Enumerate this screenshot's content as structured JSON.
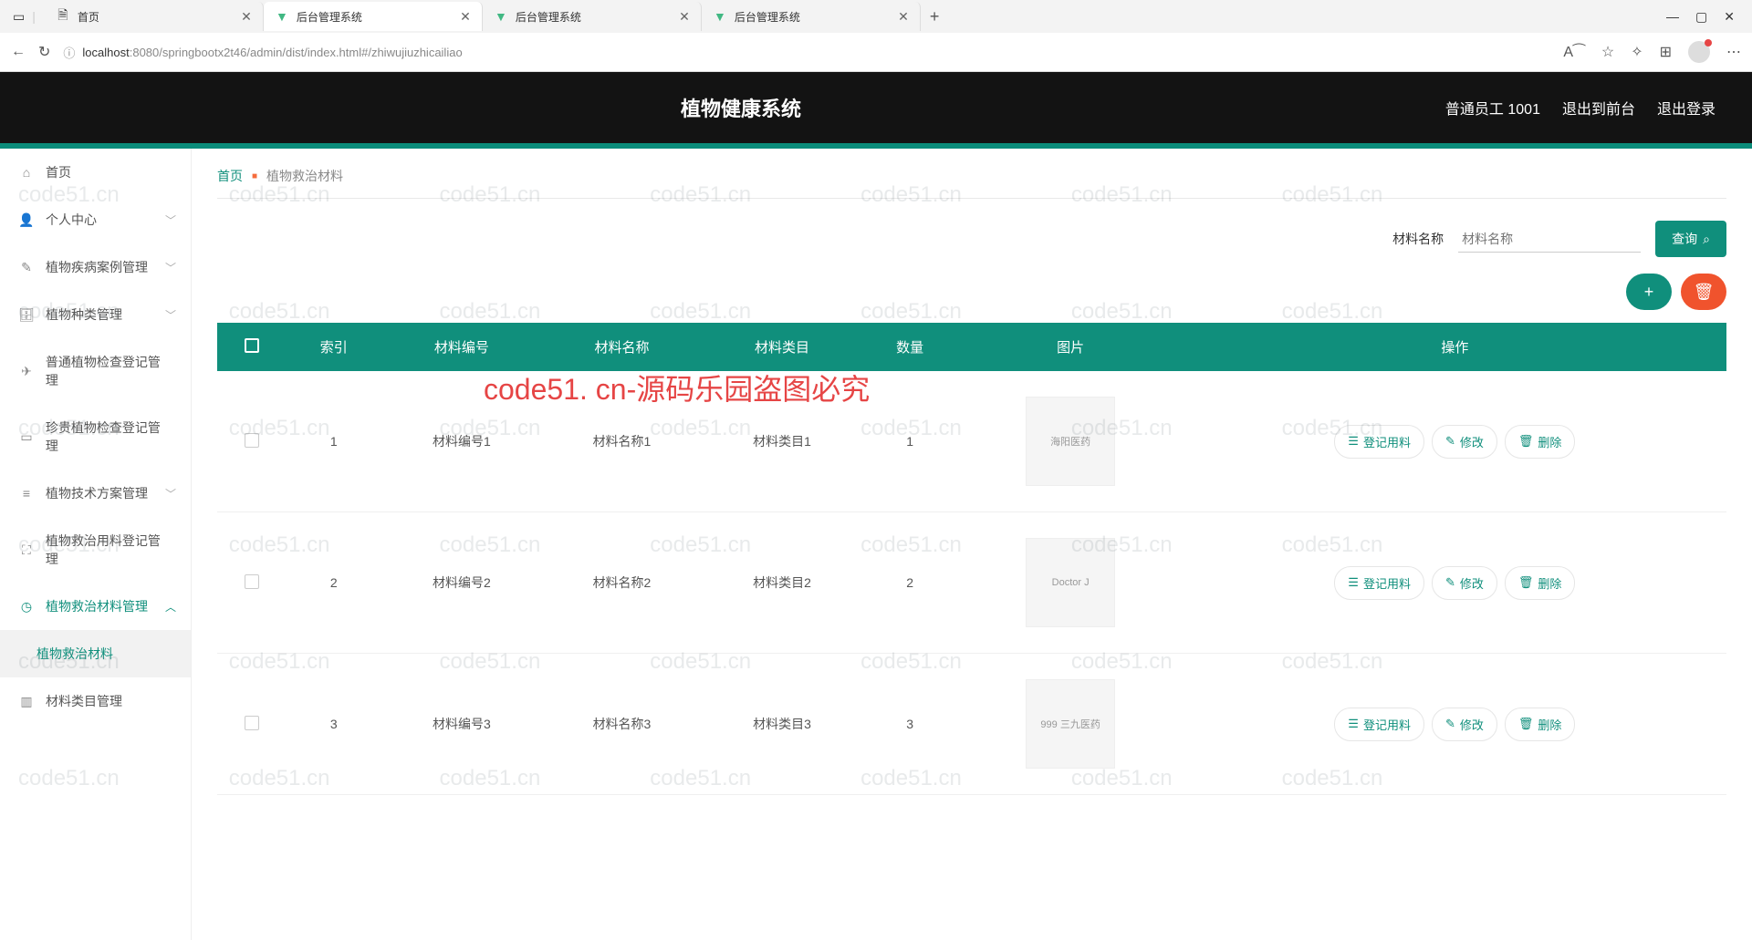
{
  "browser": {
    "tabs": [
      {
        "title": "首页",
        "icon": "doc"
      },
      {
        "title": "后台管理系统",
        "icon": "vue"
      },
      {
        "title": "后台管理系统",
        "icon": "vue"
      },
      {
        "title": "后台管理系统",
        "icon": "vue"
      }
    ],
    "url_host": "localhost",
    "url_port_path": ":8080/springbootx2t46/admin/dist/index.html#/zhiwujiuzhicailiao"
  },
  "header": {
    "title": "植物健康系统",
    "user_role": "普通员工",
    "user_id": "1001",
    "link_front": "退出到前台",
    "link_logout": "退出登录"
  },
  "sidebar": {
    "items": [
      {
        "label": "首页",
        "icon": "home"
      },
      {
        "label": "个人中心",
        "icon": "user",
        "chev": true
      },
      {
        "label": "植物疾病案例管理",
        "icon": "edit",
        "chev": true
      },
      {
        "label": "植物种类管理",
        "icon": "briefcase",
        "chev": true
      },
      {
        "label": "普通植物检查登记管理",
        "icon": "send"
      },
      {
        "label": "珍贵植物检查登记管理",
        "icon": "card"
      },
      {
        "label": "植物技术方案管理",
        "icon": "list",
        "chev": true
      },
      {
        "label": "植物救治用料登记管理",
        "icon": "scan"
      },
      {
        "label": "植物救治材料管理",
        "icon": "clock",
        "chev": true,
        "open": true
      },
      {
        "label": "植物救治材料",
        "sub": true
      },
      {
        "label": "材料类目管理",
        "icon": "bar"
      }
    ]
  },
  "breadcrumb": {
    "home": "首页",
    "current": "植物救治材料"
  },
  "filter": {
    "label": "材料名称",
    "placeholder": "材料名称",
    "query_btn": "查询"
  },
  "table": {
    "headers": [
      "索引",
      "材料编号",
      "材料名称",
      "材料类目",
      "数量",
      "图片",
      "操作"
    ],
    "rows": [
      {
        "idx": "1",
        "code": "材料编号1",
        "name": "材料名称1",
        "cat": "材料类目1",
        "qty": "1",
        "img": "海阳医药"
      },
      {
        "idx": "2",
        "code": "材料编号2",
        "name": "材料名称2",
        "cat": "材料类目2",
        "qty": "2",
        "img": "Doctor J"
      },
      {
        "idx": "3",
        "code": "材料编号3",
        "name": "材料名称3",
        "cat": "材料类目3",
        "qty": "3",
        "img": "999 三九医药"
      }
    ],
    "op_register": "登记用料",
    "op_edit": "修改",
    "op_delete": "删除"
  },
  "watermark": {
    "text": "code51.cn",
    "banner": "code51. cn-源码乐园盗图必究"
  }
}
